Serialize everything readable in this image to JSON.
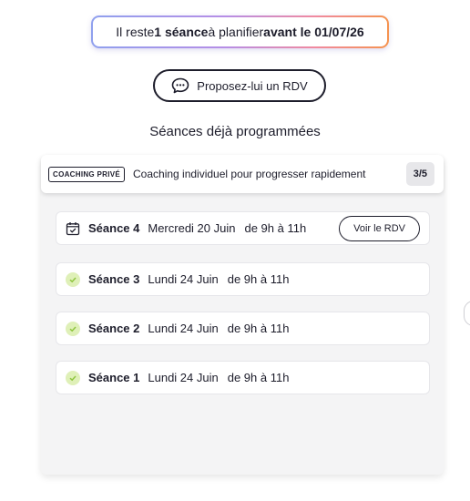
{
  "banner": {
    "prefix": "Il reste ",
    "count": "1 séance",
    "middle": " à planifier ",
    "deadline": "avant le 01/07/26"
  },
  "propose_button": {
    "label": "Proposez-lui un RDV",
    "icon": "chat-bubble-icon"
  },
  "section_title": "Séances déjà programmées",
  "coaching": {
    "tag": "COACHING PRIVÉ",
    "description": "Coaching individuel pour progresser rapidement",
    "progress": "3/5"
  },
  "sessions": [
    {
      "label": "Séance 4",
      "date": "Mercredi 20 Juin",
      "time": "de 9h à 11h",
      "status": "scheduled",
      "icon": "calendar-check-icon",
      "action": "Voir le RDV"
    },
    {
      "label": "Séance 3",
      "date": "Lundi 24 Juin",
      "time": "de 9h à 11h",
      "status": "done",
      "icon": "check-icon"
    },
    {
      "label": "Séance 2",
      "date": "Lundi 24 Juin",
      "time": "de 9h à 11h",
      "status": "done",
      "icon": "check-icon"
    },
    {
      "label": "Séance 1",
      "date": "Lundi 24 Juin",
      "time": "de 9h à 11h",
      "status": "done",
      "icon": "check-icon"
    }
  ],
  "colors": {
    "text": "#1d1d2b",
    "panel_bg": "#f4f4f5",
    "check_bg": "#dff0b8",
    "check_mark": "#8fc640",
    "gradient": [
      "#8fa0ee",
      "#b68ee6",
      "#f08aa0",
      "#f5934f"
    ]
  }
}
